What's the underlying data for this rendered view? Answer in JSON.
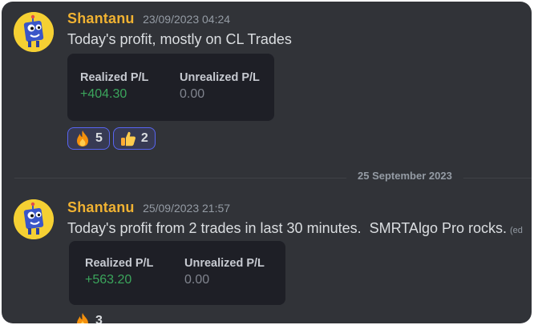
{
  "messages": [
    {
      "username": "Shantanu",
      "timestamp": "23/09/2023 04:24",
      "text": "Today's profit, mostly on CL Trades",
      "edited": "",
      "embed": {
        "realized_label": "Realized P/L",
        "realized_value": "+404.30",
        "unrealized_label": "Unrealized P/L",
        "unrealized_value": "0.00"
      },
      "reactions": [
        {
          "emoji": "fire-emoji",
          "count": "5"
        },
        {
          "emoji": "thumbs-up-emoji",
          "count": "2"
        }
      ]
    },
    {
      "username": "Shantanu",
      "timestamp": "25/09/2023 21:57",
      "text": "Today's profit from 2 trades in last 30 minutes.  SMRTAlgo Pro rocks.",
      "edited": "(ed",
      "embed": {
        "realized_label": "Realized P/L",
        "realized_value": "+563.20",
        "unrealized_label": "Unrealized P/L",
        "unrealized_value": "0.00"
      },
      "reactions": [
        {
          "emoji": "fire-emoji",
          "count": "3"
        }
      ]
    }
  ],
  "date_divider": "25 September 2023",
  "colors": {
    "background": "#313338",
    "username": "#f0b232",
    "profit_green": "#3ba55c",
    "reaction_border": "#5865f2",
    "avatar_bg": "#f5d033"
  }
}
